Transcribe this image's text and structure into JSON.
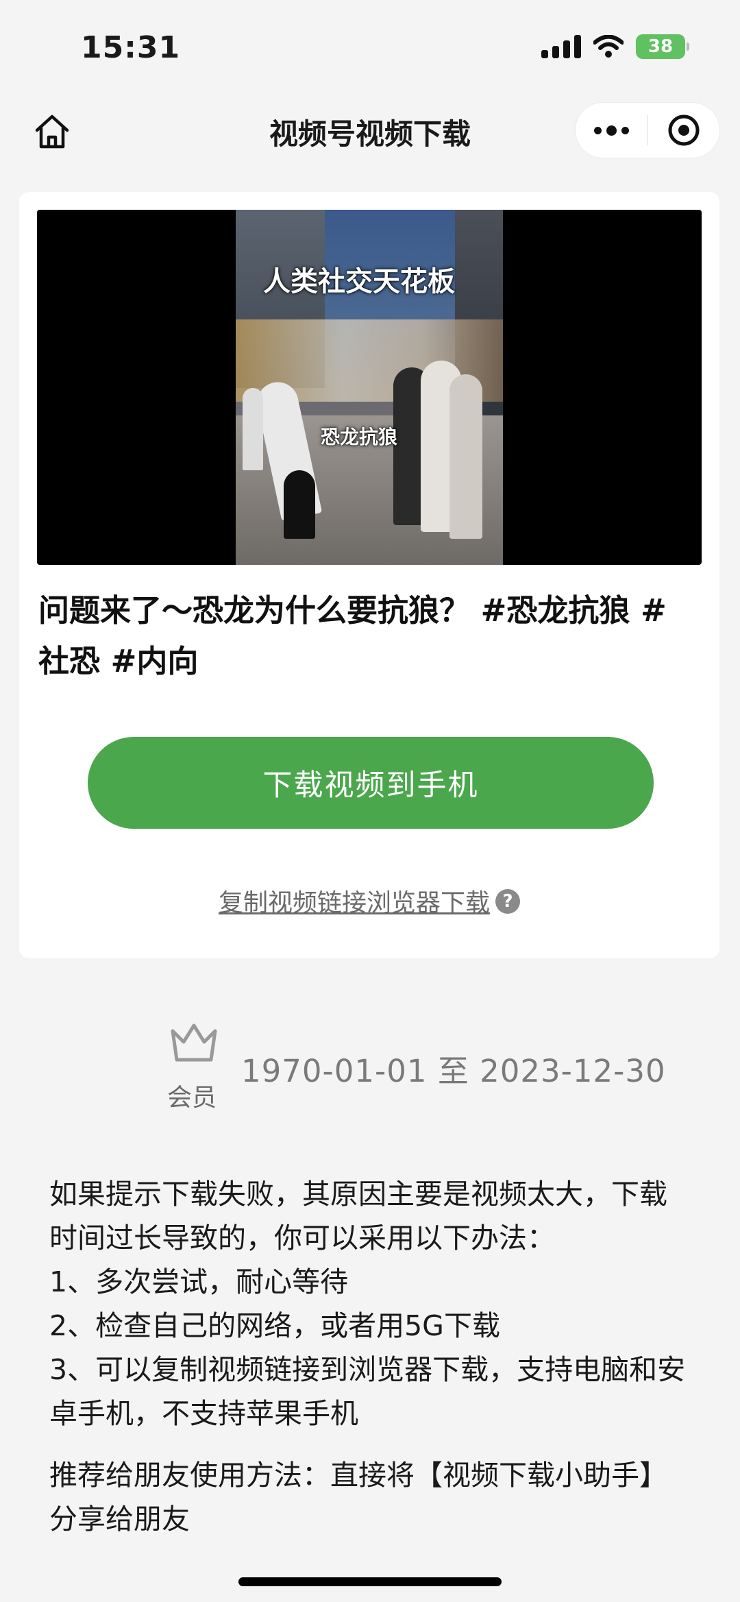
{
  "status_bar": {
    "time": "15:31",
    "battery": "38"
  },
  "nav": {
    "title": "视频号视频下载"
  },
  "video": {
    "caption_top": "人类社交天花板",
    "caption_mid": "恐龙抗狼",
    "title": "问题来了～恐龙为什么要抗狼？ #恐龙抗狼 #社恐 #内向"
  },
  "actions": {
    "download_label": "下载视频到手机",
    "copy_link_label": "复制视频链接浏览器下载",
    "help_symbol": "?"
  },
  "membership": {
    "label": "会员",
    "dates": "1970-01-01 至 2023-12-30"
  },
  "notes": {
    "lines": [
      "如果提示下载失败，其原因主要是视频太大，下载时间过长导致的，你可以采用以下办法：",
      "1、多次尝试，耐心等待",
      "2、检查自己的网络，或者用5G下载",
      "3、可以复制视频链接到浏览器下载，支持电脑和安卓手机，不支持苹果手机"
    ],
    "recommend": "推荐给朋友使用方法：直接将【视频下载小助手】分享给朋友"
  }
}
